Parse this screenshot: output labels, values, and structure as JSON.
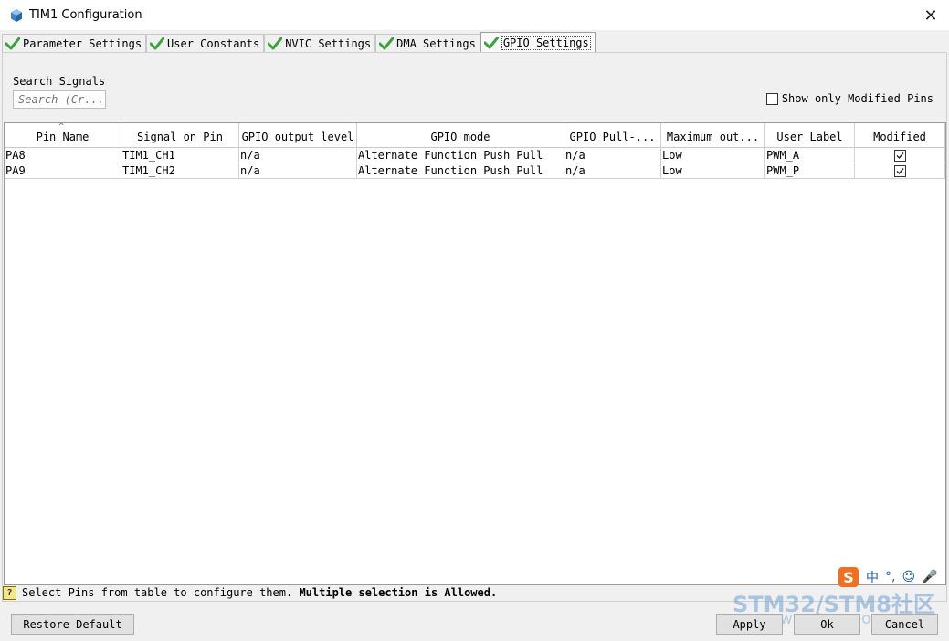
{
  "window": {
    "title": "TIM1 Configuration",
    "close_symbol": "✕"
  },
  "tabs": [
    {
      "label": "Parameter Settings"
    },
    {
      "label": "User Constants"
    },
    {
      "label": "NVIC Settings"
    },
    {
      "label": "DMA Settings"
    },
    {
      "label": "GPIO Settings",
      "active": true
    }
  ],
  "search": {
    "label": "Search Signals",
    "placeholder": "Search (Cr..."
  },
  "show_only_modified": {
    "label": "Show only Modified Pins",
    "checked": false
  },
  "table": {
    "columns": [
      "Pin Name",
      "Signal on Pin",
      "GPIO output level",
      "GPIO mode",
      "GPIO Pull-...",
      "Maximum out...",
      "User Label",
      "Modified"
    ],
    "rows": [
      {
        "pin": "PA8",
        "signal": "TIM1_CH1",
        "output_level": "n/a",
        "mode": "Alternate Function Push Pull",
        "pull": "n/a",
        "max_speed": "Low",
        "user_label": "PWM_A",
        "modified": true
      },
      {
        "pin": "PA9",
        "signal": "TIM1_CH2",
        "output_level": "n/a",
        "mode": "Alternate Function Push Pull",
        "pull": "n/a",
        "max_speed": "Low",
        "user_label": "PWM_P",
        "modified": true
      }
    ]
  },
  "status": {
    "icon": "?",
    "text": "Select Pins from table to configure them.",
    "bold_text": "Multiple selection is Allowed."
  },
  "buttons": {
    "restore_default": "Restore Default",
    "apply": "Apply",
    "ok": "Ok",
    "cancel": "Cancel"
  },
  "overlay": {
    "watermark": "STM32/STM8社区",
    "watermark_url": "www.stmcu.org",
    "ime_logo": "S",
    "ime_items": [
      "中",
      "°,",
      "☺",
      "🎤"
    ]
  },
  "colors": {
    "check_green": "#3ca23c",
    "app_icon_blue": "#3b82c4",
    "watermark": "#6ea0d2",
    "ime_orange": "#f07020"
  }
}
